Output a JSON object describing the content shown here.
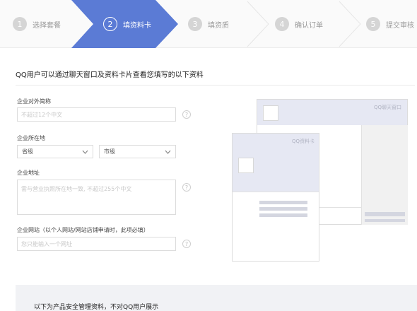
{
  "steps": [
    {
      "num": "1",
      "label": "选择套餐",
      "state": "done"
    },
    {
      "num": "2",
      "label": "填资料卡",
      "state": "active"
    },
    {
      "num": "3",
      "label": "填资质",
      "state": "pending"
    },
    {
      "num": "4",
      "label": "确认订单",
      "state": "pending"
    },
    {
      "num": "5",
      "label": "提交审核",
      "state": "pending"
    }
  ],
  "colors": {
    "accent": "#5b7bd5",
    "band": "#f1f2f5",
    "preview": "#e6e8f3"
  },
  "heading": "QQ用户可以通过聊天窗口及资料卡片查看您填写的以下资料",
  "form": {
    "name": {
      "label": "企业对外简称",
      "placeholder": "不超过12个中文"
    },
    "location": {
      "label": "企业所在地",
      "province": "省级",
      "city": "市级"
    },
    "address": {
      "label": "企业地址",
      "placeholder": "需与营业执照所在地一致, 不超过255个中文"
    },
    "website": {
      "label": "企业网站（以个人网站/网站店铺申请时，此项必填）",
      "placeholder": "您只能输入一个网址"
    },
    "help": "?"
  },
  "preview": {
    "chat_window_title": "QQ聊天窗口",
    "profile_card_title": "QQ资料卡"
  },
  "footer": "以下为产品安全管理资料，不对QQ用户展示"
}
